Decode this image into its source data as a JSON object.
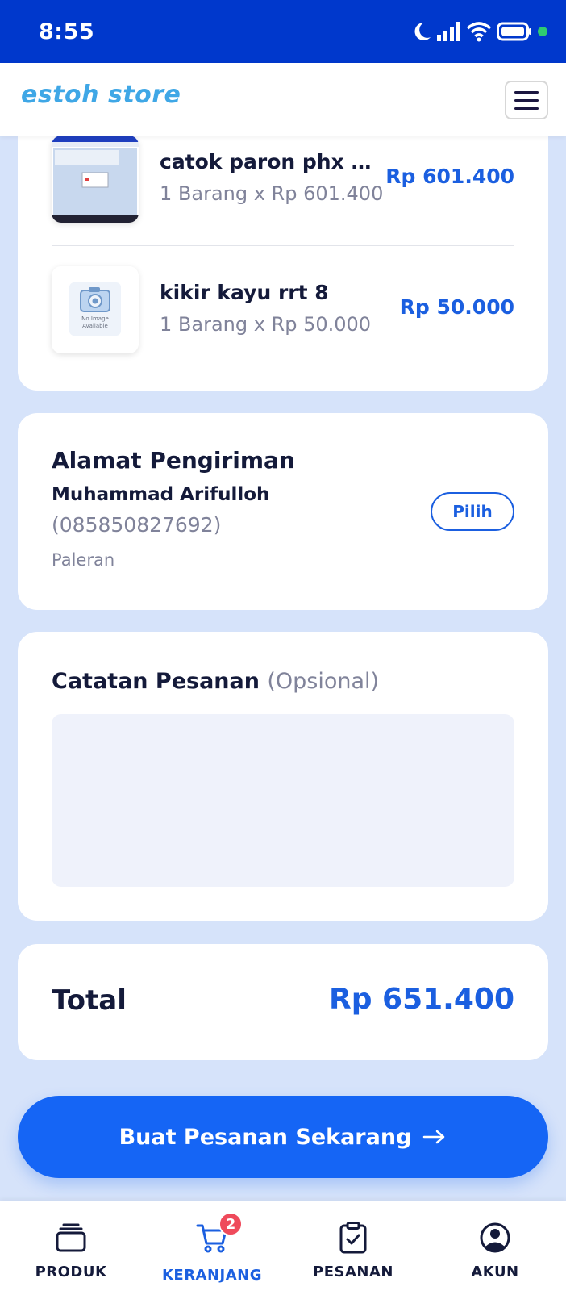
{
  "status_bar": {
    "time": "8:55",
    "icons": [
      "moon-icon",
      "signal-icon",
      "wifi-icon",
      "battery-icon",
      "privacy-dot-icon"
    ]
  },
  "header": {
    "logo_text": "estoh store",
    "menu_icon": "hamburger-menu-icon"
  },
  "cart_items": [
    {
      "name": "catok paron phx me...",
      "qty_line": "1 Barang x Rp 601.400",
      "price": "Rp 601.400",
      "thumb": "screenshot-thumbnail"
    },
    {
      "name": "kikir kayu rrt 8",
      "qty_line": "1 Barang x Rp 50.000",
      "price": "Rp 50.000",
      "thumb": "no-image-placeholder",
      "thumb_text": "No Image Available"
    }
  ],
  "address": {
    "title": "Alamat Pengiriman",
    "name": "Muhammad Arifulloh",
    "phone": "(085850827692)",
    "city": "Paleran",
    "choose_label": "Pilih"
  },
  "notes": {
    "title": "Catatan Pesanan",
    "optional": "(Opsional)",
    "value": ""
  },
  "total": {
    "label": "Total",
    "value": "Rp 651.400"
  },
  "order_button": {
    "label": "Buat Pesanan Sekarang"
  },
  "bottom_nav": {
    "items": [
      {
        "label": "PRODUK",
        "icon": "product-box-icon"
      },
      {
        "label": "KERANJANG",
        "icon": "cart-icon",
        "badge": "2",
        "active": true
      },
      {
        "label": "PESANAN",
        "icon": "clipboard-check-icon"
      },
      {
        "label": "AKUN",
        "icon": "account-icon"
      }
    ]
  },
  "colors": {
    "status_bar": "#0038cc",
    "background": "#d6e3fa",
    "accent": "#1b5fe0",
    "button": "#1565f5",
    "badge": "#ef4a5b",
    "text_dark": "#141a3a",
    "text_muted": "#80839a"
  }
}
